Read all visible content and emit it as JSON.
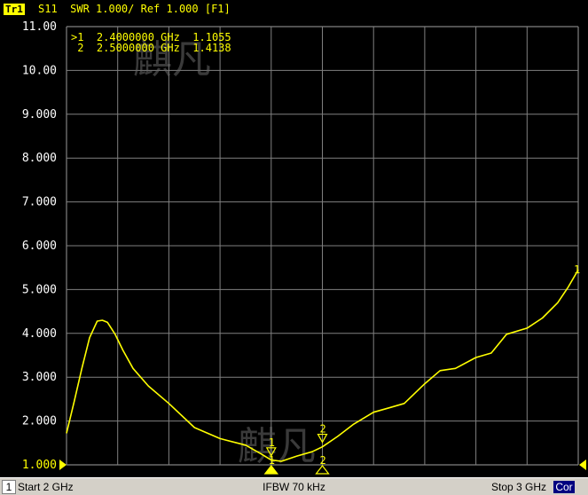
{
  "header": {
    "trace_badge": "Tr1",
    "trace_text": "S11  SWR 1.000/ Ref 1.000 [F1]"
  },
  "markers_table": [
    {
      "label": ">1",
      "freq": "2.4000000 GHz",
      "value": "1.1055"
    },
    {
      "label": " 2",
      "freq": "2.5000000 GHz",
      "value": "1.4138"
    }
  ],
  "markers_table_text": [
    ">1  2.4000000 GHz  1.1055",
    " 2  2.5000000 GHz  1.4138"
  ],
  "watermark_text": "麒凡",
  "colors": {
    "background": "#000000",
    "grid": "#808080",
    "trace": "#ffff00",
    "axis_text": "#ffffff",
    "status_bar": "#d4d0c8",
    "cor_badge": "#000080"
  },
  "chart_data": {
    "type": "line",
    "title": "S11  SWR 1.000/ Ref 1.000 [F1]",
    "xlabel": "",
    "ylabel": "",
    "xunit": "GHz",
    "xlim": [
      2.0,
      3.0
    ],
    "ylim": [
      1.0,
      11.0
    ],
    "grid": true,
    "legend": "none",
    "ytick_labels": [
      "11.00",
      "10.00",
      "9.000",
      "8.000",
      "7.000",
      "6.000",
      "5.000",
      "4.000",
      "3.000",
      "2.000",
      "1.000"
    ],
    "reference_label": "1.000",
    "series": [
      {
        "name": "",
        "color": "#ffff00",
        "x": [
          2.0,
          2.015,
          2.03,
          2.045,
          2.06,
          2.07,
          2.08,
          2.095,
          2.11,
          2.13,
          2.16,
          2.2,
          2.25,
          2.3,
          2.35,
          2.38,
          2.4,
          2.42,
          2.45,
          2.48,
          2.5,
          2.53,
          2.56,
          2.6,
          2.63,
          2.66,
          2.7,
          2.73,
          2.76,
          2.8,
          2.83,
          2.86,
          2.9,
          2.93,
          2.96,
          2.98,
          3.0
        ],
        "values": [
          1.72,
          2.45,
          3.2,
          3.9,
          4.28,
          4.3,
          4.25,
          3.98,
          3.62,
          3.2,
          2.8,
          2.4,
          1.85,
          1.6,
          1.45,
          1.25,
          1.11,
          1.08,
          1.2,
          1.3,
          1.41,
          1.65,
          1.92,
          2.2,
          2.3,
          2.4,
          2.85,
          3.15,
          3.2,
          3.45,
          3.55,
          3.98,
          4.12,
          4.35,
          4.7,
          5.05,
          5.45
        ]
      }
    ],
    "trace_end_label": "1",
    "markers": [
      {
        "label": "1",
        "x": 2.4,
        "y": 1.1055,
        "active": true
      },
      {
        "label": "2",
        "x": 2.5,
        "y": 1.4138,
        "active": false
      }
    ]
  },
  "status_bar": {
    "channel": "1",
    "start": "Start 2 GHz",
    "ifbw": "IFBW 70 kHz",
    "stop": "Stop 3 GHz",
    "cor": "Cor"
  }
}
